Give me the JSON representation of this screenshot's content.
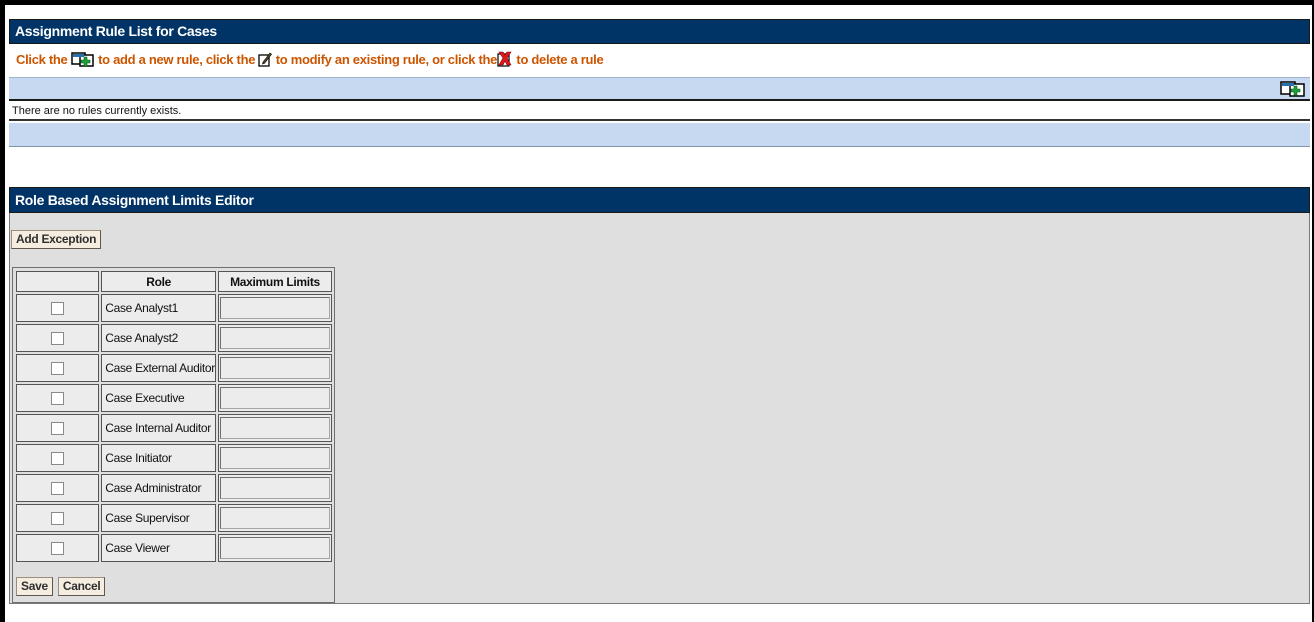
{
  "rules_panel": {
    "title": "Assignment Rule List for Cases",
    "instructions": {
      "part1": "Click the ",
      "part2": " to add a new rule, click the ",
      "part3": " to modify an existing rule, or click the",
      "part4": " to delete a rule"
    },
    "empty_message": "There are no rules currently exists."
  },
  "limits_panel": {
    "title": "Role Based Assignment Limits Editor",
    "add_exception_label": "Add Exception",
    "columns": {
      "select": "",
      "role": "Role",
      "max_limits": "Maximum Limits"
    },
    "rows": [
      {
        "role": "Case Analyst1",
        "checked": false,
        "limit": ""
      },
      {
        "role": "Case Analyst2",
        "checked": false,
        "limit": ""
      },
      {
        "role": "Case External Auditor",
        "checked": false,
        "limit": ""
      },
      {
        "role": "Case Executive",
        "checked": false,
        "limit": ""
      },
      {
        "role": "Case Internal Auditor",
        "checked": false,
        "limit": ""
      },
      {
        "role": "Case Initiator",
        "checked": false,
        "limit": ""
      },
      {
        "role": "Case Administrator",
        "checked": false,
        "limit": ""
      },
      {
        "role": "Case Supervisor",
        "checked": false,
        "limit": ""
      },
      {
        "role": "Case Viewer",
        "checked": false,
        "limit": ""
      }
    ],
    "save_label": "Save",
    "cancel_label": "Cancel"
  },
  "colors": {
    "header_bg": "#003366",
    "instruction_text": "#cc5500",
    "toolbar_bg": "#c6d9f0",
    "editor_bg": "#dfdfdf"
  },
  "icons": [
    "add-rule-icon",
    "edit-rule-icon",
    "delete-rule-icon"
  ]
}
